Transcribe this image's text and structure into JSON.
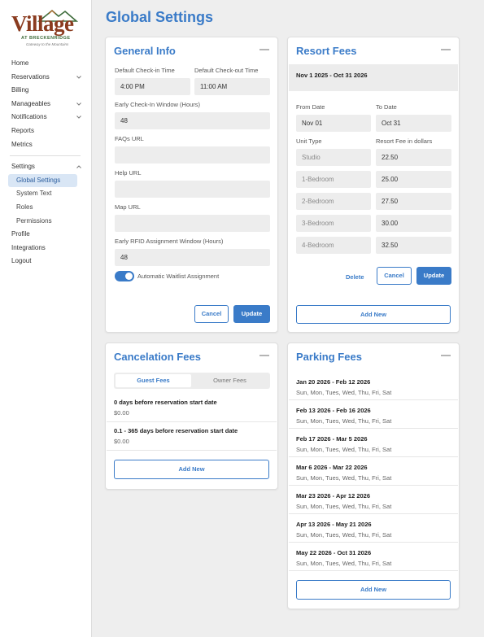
{
  "logo": {
    "name": "Village",
    "line1": "AT BRECKENRIDGE",
    "line2": "Gateway to the Mountains"
  },
  "sidebar": {
    "items": [
      {
        "label": "Home",
        "chevron": false
      },
      {
        "label": "Reservations",
        "chevron": "down"
      },
      {
        "label": "Billing",
        "chevron": false
      },
      {
        "label": "Manageables",
        "chevron": "down"
      },
      {
        "label": "Notifications",
        "chevron": "down"
      },
      {
        "label": "Reports",
        "chevron": false
      },
      {
        "label": "Metrics",
        "chevron": false
      }
    ],
    "settings": {
      "label": "Settings",
      "chevron": "up",
      "children": [
        "Global Settings",
        "System Text",
        "Roles",
        "Permissions"
      ],
      "active": "Global Settings"
    },
    "bottom_items": [
      "Profile",
      "Integrations",
      "Logout"
    ]
  },
  "page_title": "Global Settings",
  "general_info": {
    "title": "General Info",
    "checkin_label": "Default Check-in Time",
    "checkin_value": "4:00 PM",
    "checkout_label": "Default Check-out Time",
    "checkout_value": "11:00 AM",
    "early_checkin_label": "Early Check-In Window (Hours)",
    "early_checkin_value": "48",
    "faqs_label": "FAQs URL",
    "faqs_value": "",
    "help_label": "Help URL",
    "help_value": "",
    "map_label": "Map URL",
    "map_value": "",
    "rfid_label": "Early RFID Assignment Window (Hours)",
    "rfid_value": "48",
    "waitlist_label": "Automatic Waitlist Assignment",
    "waitlist_on": true,
    "cancel_label": "Cancel",
    "update_label": "Update"
  },
  "resort_fees": {
    "title": "Resort Fees",
    "period": "Nov 1 2025 - Oct 31 2026",
    "from_label": "From Date",
    "from_value": "Nov 01",
    "to_label": "To Date",
    "to_value": "Oct 31",
    "unit_type_label": "Unit Type",
    "fee_label": "Resort Fee in dollars",
    "rows": [
      {
        "unit": "Studio",
        "fee": "22.50"
      },
      {
        "unit": "1-Bedroom",
        "fee": "25.00"
      },
      {
        "unit": "2-Bedroom",
        "fee": "27.50"
      },
      {
        "unit": "3-Bedroom",
        "fee": "30.00"
      },
      {
        "unit": "4-Bedroom",
        "fee": "32.50"
      }
    ],
    "delete_label": "Delete",
    "cancel_label": "Cancel",
    "update_label": "Update",
    "add_new_label": "Add New"
  },
  "cancelation_fees": {
    "title": "Cancelation Fees",
    "tabs": [
      "Guest Fees",
      "Owner Fees"
    ],
    "active_tab": "Guest Fees",
    "rules": [
      {
        "title": "0 days before reservation start date",
        "amount": "$0.00"
      },
      {
        "title": "0.1 - 365 days before reservation start date",
        "amount": "$0.00"
      }
    ],
    "add_new_label": "Add New"
  },
  "parking_fees": {
    "title": "Parking Fees",
    "rows": [
      {
        "range": "Jan 20 2026 - Feb 12 2026",
        "days": "Sun, Mon, Tues, Wed, Thu, Fri, Sat"
      },
      {
        "range": "Feb 13 2026 - Feb 16 2026",
        "days": "Sun, Mon, Tues, Wed, Thu, Fri, Sat"
      },
      {
        "range": "Feb 17 2026 - Mar 5 2026",
        "days": "Sun, Mon, Tues, Wed, Thu, Fri, Sat"
      },
      {
        "range": "Mar 6 2026 - Mar 22 2026",
        "days": "Sun, Mon, Tues, Wed, Thu, Fri, Sat"
      },
      {
        "range": "Mar 23 2026 - Apr 12 2026",
        "days": "Sun, Mon, Tues, Wed, Thu, Fri, Sat"
      },
      {
        "range": "Apr 13 2026 - May 21 2026",
        "days": "Sun, Mon, Tues, Wed, Thu, Fri, Sat"
      },
      {
        "range": "May 22 2026 - Oct 31 2026",
        "days": "Sun, Mon, Tues, Wed, Thu, Fri, Sat"
      }
    ],
    "add_new_label": "Add New"
  },
  "colors": {
    "accent": "#3a7bc8",
    "logo_brown": "#8a3b1f",
    "logo_green": "#3d6b3a",
    "field_bg": "#ededed",
    "active_nav_bg": "#d9e6f5"
  }
}
